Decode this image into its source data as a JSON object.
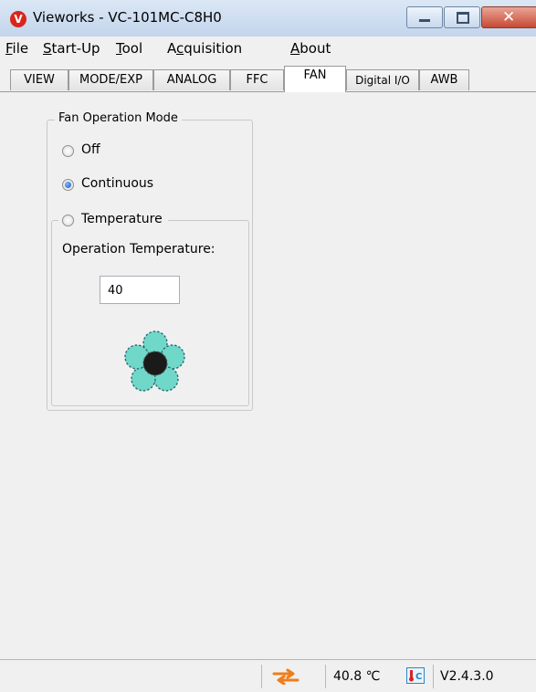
{
  "window": {
    "title": "Vieworks - VC-101MC-C8H0",
    "app_icon": "vieworks-v-logo-icon",
    "controls": [
      "minimize-icon",
      "maximize-icon",
      "close-icon"
    ]
  },
  "menu": {
    "items": [
      {
        "label": "File",
        "accel": "F"
      },
      {
        "label": "Start-Up",
        "accel": "S"
      },
      {
        "label": "Tool",
        "accel": "T"
      },
      {
        "label": "Acquisition",
        "accel": "c"
      },
      {
        "label": "About",
        "accel": "A"
      }
    ]
  },
  "tabs": [
    {
      "label": "VIEW",
      "active": false
    },
    {
      "label": "MODE/EXP",
      "active": false
    },
    {
      "label": "ANALOG",
      "active": false
    },
    {
      "label": "FFC",
      "active": false
    },
    {
      "label": "FAN",
      "active": true
    },
    {
      "label": "Digital I/O",
      "active": false
    },
    {
      "label": "AWB",
      "active": false
    }
  ],
  "fan": {
    "group_title": "Fan Operation Mode",
    "options": [
      {
        "label": "Off",
        "checked": false
      },
      {
        "label": "Continuous",
        "checked": true
      },
      {
        "label": "Temperature",
        "checked": false
      }
    ],
    "operation_temperature_label": "Operation Temperature:",
    "operation_temperature_value": "40",
    "fan_icon": "fan-flower-icon"
  },
  "status": {
    "connection_icon": "connection-arrows-icon",
    "temperature": "40.8 ℃",
    "alarm_icon": "temperature-alarm-icon",
    "version": "V2.4.3.0"
  },
  "colors": {
    "fan_petal": "#6fd8c8",
    "fan_center": "#1a1a1a",
    "arrow": "#f07d1a",
    "alarm_red": "#d52424",
    "alarm_blue": "#2b86c6"
  }
}
